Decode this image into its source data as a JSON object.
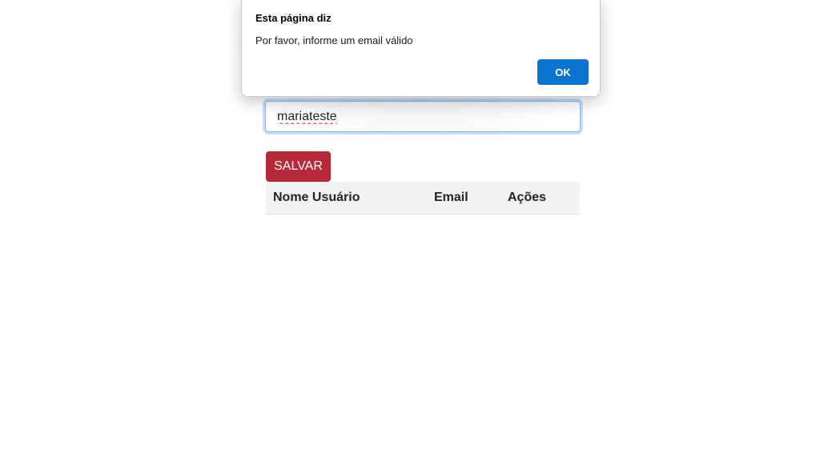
{
  "alert": {
    "title": "Esta página diz",
    "message": "Por favor, informe um email válido",
    "ok_label": "OK"
  },
  "form": {
    "email_value": "mariateste",
    "save_label": "SALVAR"
  },
  "table": {
    "headers": [
      "Nome Usuário",
      "Email",
      "Ações"
    ]
  },
  "colors": {
    "save_button": "#b8283b",
    "ok_button": "#0b74d1",
    "table_header_bg": "#f2f2f2"
  }
}
